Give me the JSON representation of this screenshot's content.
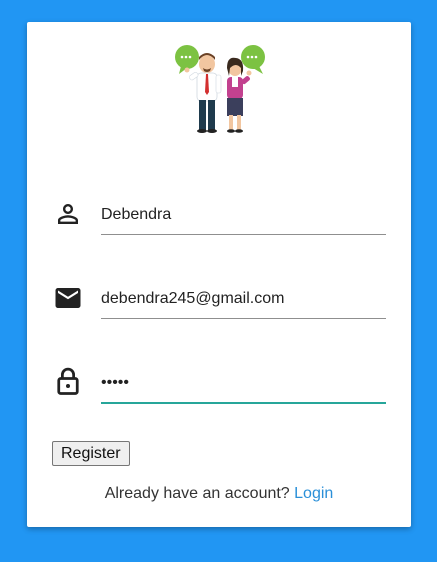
{
  "form": {
    "name": {
      "value": "Debendra",
      "icon": "person-icon"
    },
    "email": {
      "value": "debendra245@gmail.com",
      "icon": "mail-icon"
    },
    "password": {
      "value": "•••••",
      "icon": "lock-icon"
    },
    "register_label": "Register",
    "login_prompt": "Already have an account?",
    "login_link": "Login"
  },
  "colors": {
    "background": "#2196f3",
    "card": "#ffffff",
    "active_underline": "#26a69a",
    "link": "#2a8fd8"
  },
  "logo": {
    "icon": "chatting-people-illustration"
  }
}
